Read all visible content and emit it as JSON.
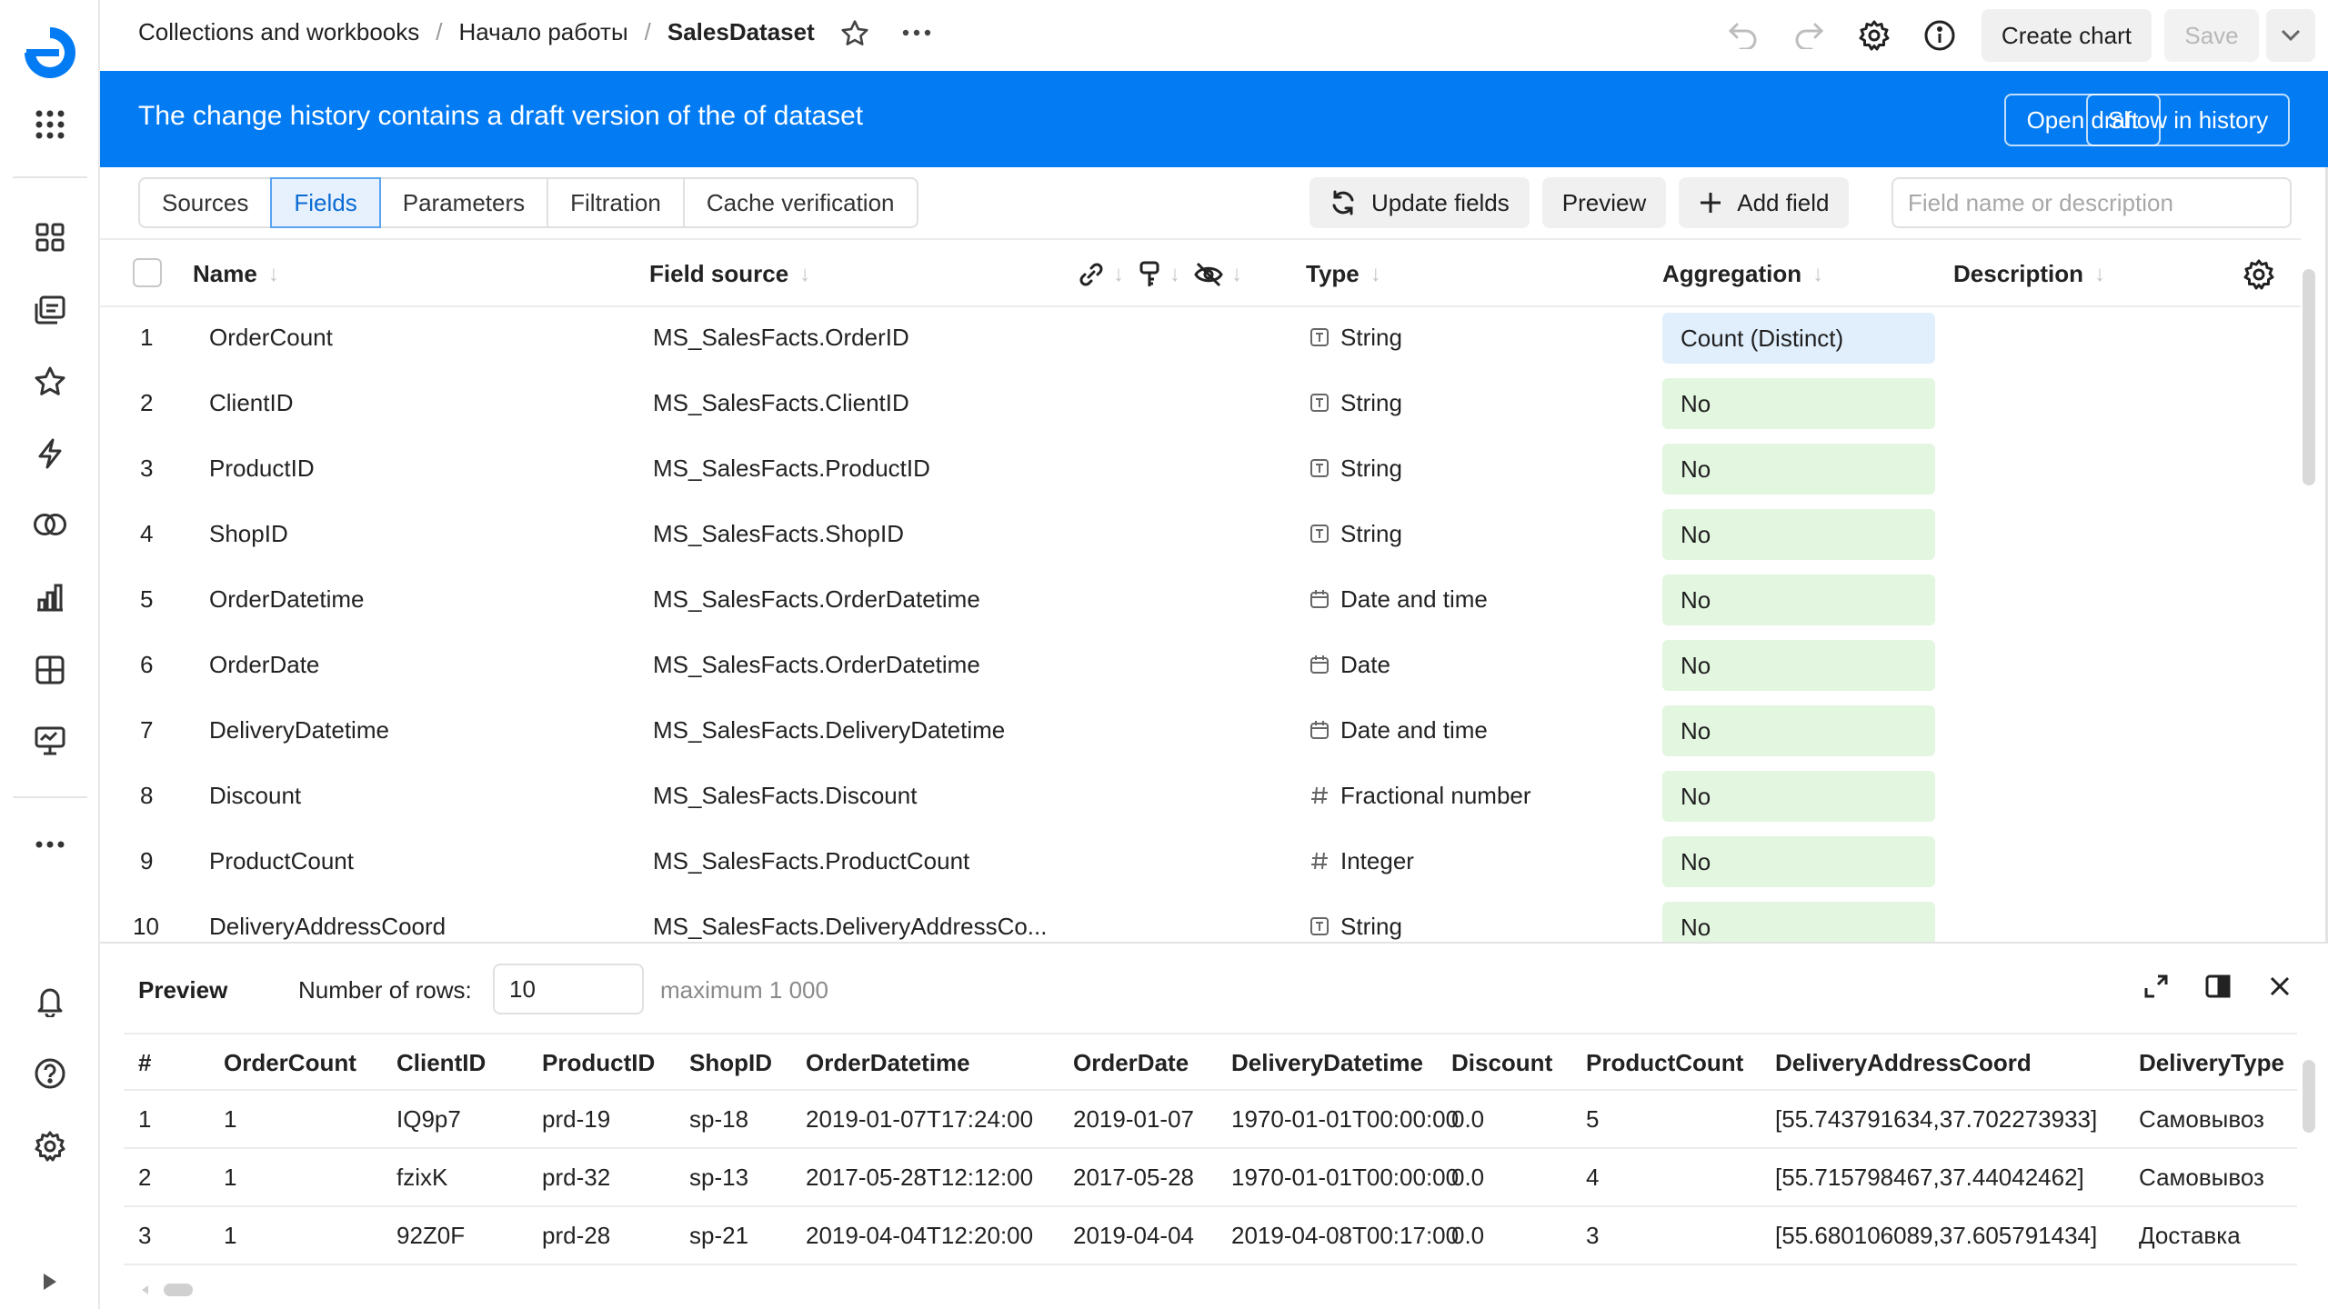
{
  "breadcrumbs": [
    "Collections and workbooks",
    "Начало работы",
    "SalesDataset"
  ],
  "header": {
    "create_chart": "Create chart",
    "save": "Save"
  },
  "banner": {
    "text": "The change history contains a draft version of the of dataset",
    "open_draft": "Open draft",
    "show_in_history": "Show in history"
  },
  "tabs": [
    "Sources",
    "Fields",
    "Parameters",
    "Filtration",
    "Cache verification"
  ],
  "active_tab": "Fields",
  "toolbar": {
    "update_fields": "Update fields",
    "preview": "Preview",
    "add_field": "Add field",
    "search_placeholder": "Field name or description"
  },
  "fields_table": {
    "headers": {
      "name": "Name",
      "source": "Field source",
      "type": "Type",
      "aggregation": "Aggregation",
      "description": "Description"
    },
    "rows": [
      {
        "n": "1",
        "name": "OrderCount",
        "source": "MS_SalesFacts.OrderID",
        "type": "String",
        "type_icon": "string-type-icon",
        "agg": "Count (Distinct)"
      },
      {
        "n": "2",
        "name": "ClientID",
        "source": "MS_SalesFacts.ClientID",
        "type": "String",
        "type_icon": "string-type-icon",
        "agg": "No"
      },
      {
        "n": "3",
        "name": "ProductID",
        "source": "MS_SalesFacts.ProductID",
        "type": "String",
        "type_icon": "string-type-icon",
        "agg": "No"
      },
      {
        "n": "4",
        "name": "ShopID",
        "source": "MS_SalesFacts.ShopID",
        "type": "String",
        "type_icon": "string-type-icon",
        "agg": "No"
      },
      {
        "n": "5",
        "name": "OrderDatetime",
        "source": "MS_SalesFacts.OrderDatetime",
        "type": "Date and time",
        "type_icon": "calendar-icon",
        "agg": "No"
      },
      {
        "n": "6",
        "name": "OrderDate",
        "source": "MS_SalesFacts.OrderDatetime",
        "type": "Date",
        "type_icon": "calendar-icon",
        "agg": "No"
      },
      {
        "n": "7",
        "name": "DeliveryDatetime",
        "source": "MS_SalesFacts.DeliveryDatetime",
        "type": "Date and time",
        "type_icon": "calendar-icon",
        "agg": "No"
      },
      {
        "n": "8",
        "name": "Discount",
        "source": "MS_SalesFacts.Discount",
        "type": "Fractional number",
        "type_icon": "hash-icon",
        "agg": "No"
      },
      {
        "n": "9",
        "name": "ProductCount",
        "source": "MS_SalesFacts.ProductCount",
        "type": "Integer",
        "type_icon": "hash-icon",
        "agg": "No"
      },
      {
        "n": "10",
        "name": "DeliveryAddressCoord",
        "source": "MS_SalesFacts.DeliveryAddressCo...",
        "type": "String",
        "type_icon": "string-type-icon",
        "agg": "No"
      }
    ]
  },
  "preview": {
    "title": "Preview",
    "rows_label": "Number of rows:",
    "rows_value": "10",
    "max_label": "maximum 1 000",
    "columns": [
      "#",
      "OrderCount",
      "ClientID",
      "ProductID",
      "ShopID",
      "OrderDatetime",
      "OrderDate",
      "DeliveryDatetime",
      "Discount",
      "ProductCount",
      "DeliveryAddressCoord",
      "DeliveryType"
    ],
    "rows": [
      [
        "1",
        "1",
        "IQ9p7",
        "prd-19",
        "sp-18",
        "2019-01-07T17:24:00",
        "2019-01-07",
        "1970-01-01T00:00:00",
        "0.0",
        "5",
        "[55.743791634,37.702273933]",
        "Самовывоз"
      ],
      [
        "2",
        "1",
        "fzixK",
        "prd-32",
        "sp-13",
        "2017-05-28T12:12:00",
        "2017-05-28",
        "1970-01-01T00:00:00",
        "0.0",
        "4",
        "[55.715798467,37.44042462]",
        "Самовывоз"
      ],
      [
        "3",
        "1",
        "92Z0F",
        "prd-28",
        "sp-21",
        "2019-04-04T12:20:00",
        "2019-04-04",
        "2019-04-08T00:17:00",
        "0.0",
        "3",
        "[55.680106089,37.605791434]",
        "Доставка"
      ]
    ]
  },
  "colors": {
    "banner": "#027bf3",
    "brand": "#027bf3",
    "agg_green": "#e3f6e0",
    "agg_blue": "#e1effd",
    "active_tab": "#e6f1fd"
  }
}
